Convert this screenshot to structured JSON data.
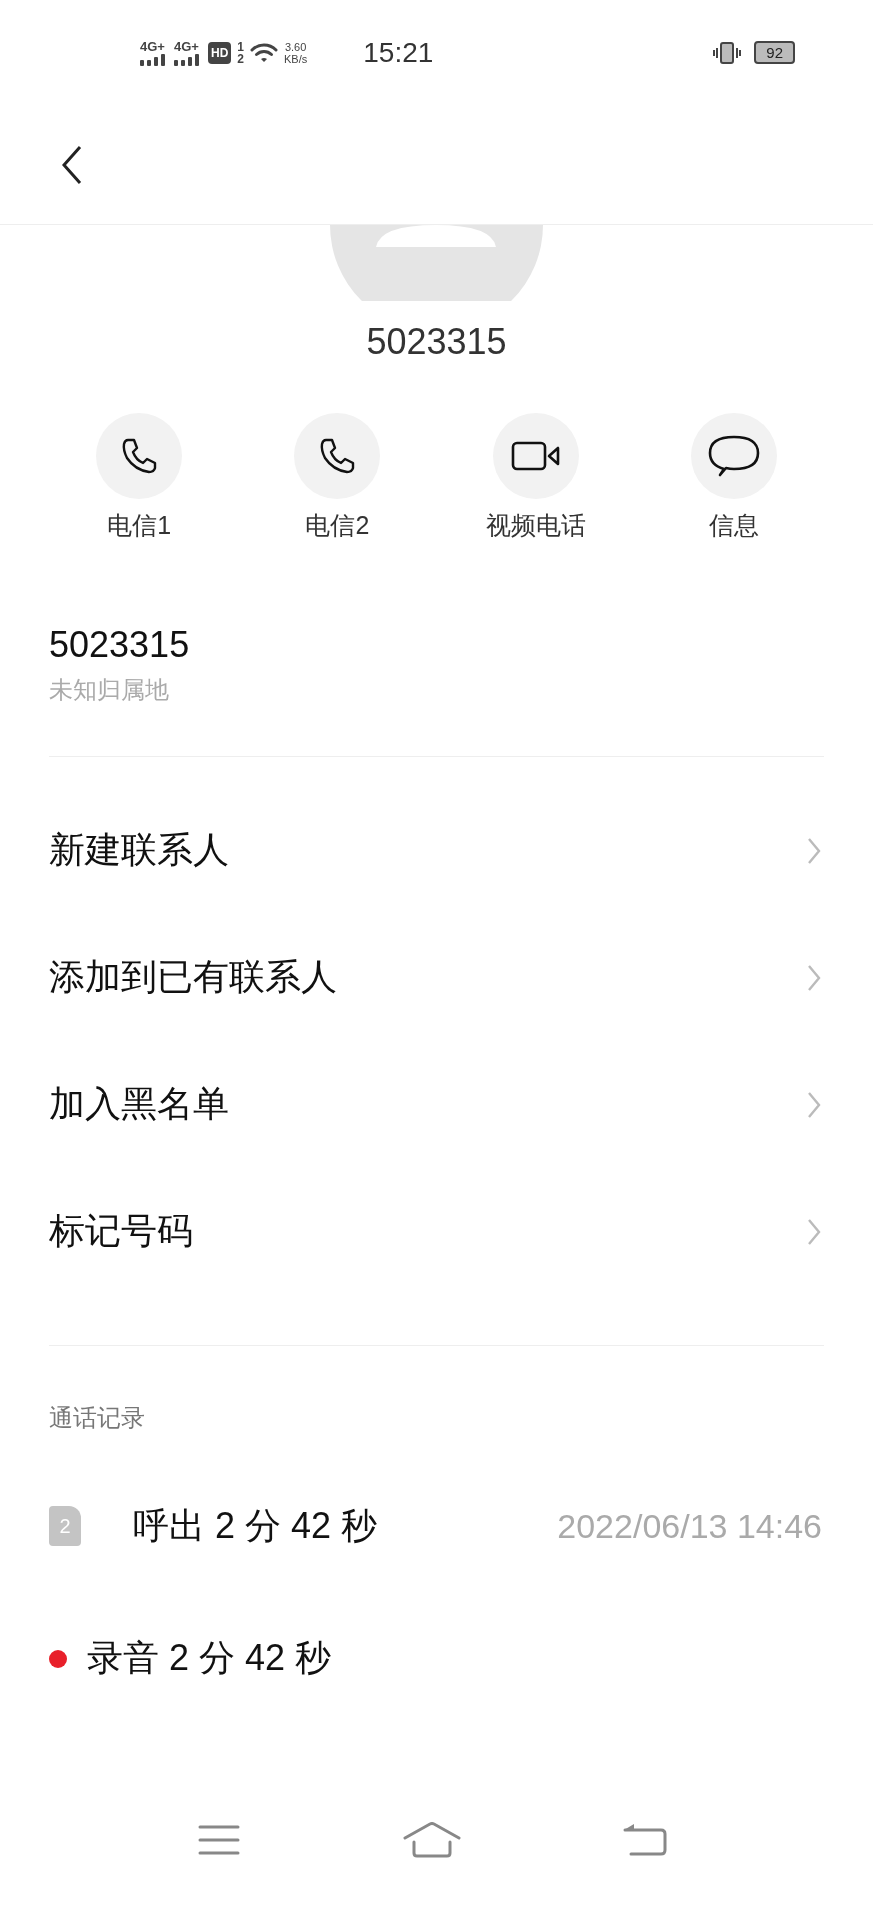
{
  "status_bar": {
    "networks": [
      {
        "label": "4G+"
      },
      {
        "label": "4G+"
      }
    ],
    "hd": {
      "label": "HD",
      "sims": [
        "1",
        "2"
      ]
    },
    "speed": {
      "value": "3.60",
      "unit": "KB/s"
    },
    "time": "15:21",
    "battery": "92"
  },
  "contact": {
    "name": "5023315"
  },
  "actions": [
    {
      "kind": "phone",
      "label": "电信1"
    },
    {
      "kind": "phone",
      "label": "电信2"
    },
    {
      "kind": "video",
      "label": "视频电话"
    },
    {
      "kind": "message",
      "label": "信息"
    }
  ],
  "number": {
    "value": "5023315",
    "location": "未知归属地"
  },
  "menu": [
    {
      "label": "新建联系人"
    },
    {
      "label": "添加到已有联系人"
    },
    {
      "label": "加入黑名单"
    },
    {
      "label": "标记号码"
    }
  ],
  "call_log": {
    "title": "通话记录",
    "entries": [
      {
        "kind": "call",
        "sim": "2",
        "text": "呼出 2 分 42 秒",
        "time": "2022/06/13 14:46"
      },
      {
        "kind": "recording",
        "color": "#e8202a",
        "text": "录音 2 分 42 秒"
      }
    ]
  }
}
